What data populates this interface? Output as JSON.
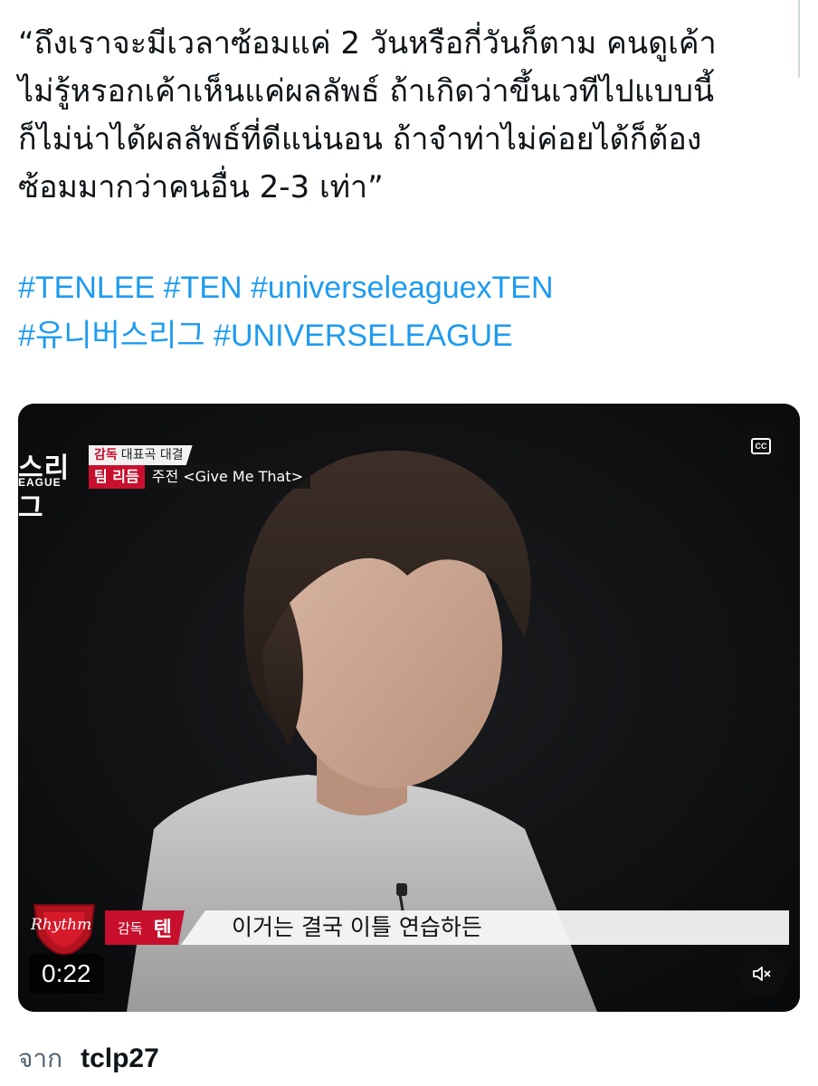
{
  "tweet": {
    "text_lines": [
      "“ถึงเราจะมีเวลาซ้อมแค่ 2 วันหรือกี่วันก็ตาม คนดูเค้า",
      "ไม่รู้หรอกเค้าเห็นแค่ผลลัพธ์ ถ้าเกิดว่าขึ้นเวทีไปแบบนี้",
      "ก็ไม่น่าได้ผลลัพธ์ที่ดีแน่นอน ถ้าจำท่าไม่ค่อยได้ก็ต้อง",
      "ซ้อมมากว่าคนอื่น 2-3 เท่า”"
    ],
    "hashtags": [
      "#TENLEE",
      "#TEN",
      "#universeleaguexTEN",
      "#유니버스리그",
      "#UNIVERSELEAGUE"
    ]
  },
  "video": {
    "logo_ko": "스리그",
    "logo_en": "EAGUE",
    "chyron_tag": "감독",
    "chyron_small": "대표곡 대결",
    "chyron_team": "팀 리듬",
    "chyron_title": "주전 <Give Me That>",
    "badge_text": "Rhythm",
    "speaker_role": "감독",
    "speaker_name": "텐",
    "subtitle": "이거는 결국 이틀 연습하든",
    "timestamp": "0:22",
    "cc_label": "CC"
  },
  "footer": {
    "from_label": "จาก",
    "author": "tclp27"
  },
  "colors": {
    "hashtag": "#1d9bf0",
    "accent_red": "#c8102e"
  },
  "icons": {
    "cc": "closed-captions-icon",
    "mute": "speaker-muted-icon"
  }
}
